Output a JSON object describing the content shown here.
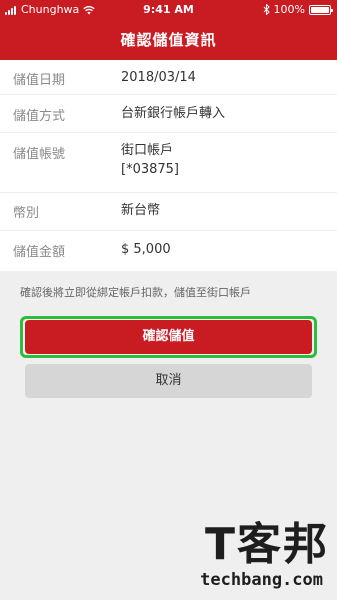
{
  "status_bar": {
    "carrier": "Chunghwa",
    "time": "9:41 AM",
    "battery": "100%"
  },
  "nav": {
    "title": "確認儲值資訊"
  },
  "info": {
    "rows": [
      {
        "label": "儲值日期",
        "value": "2018/03/14"
      },
      {
        "label": "儲值方式",
        "value": "台新銀行帳戶轉入"
      },
      {
        "label": "儲值帳號",
        "value": "街口帳戶",
        "value2": "[*03875]"
      },
      {
        "label": "幣別",
        "value": "新台幣"
      },
      {
        "label": "儲值金額",
        "value": "$ 5,000"
      }
    ]
  },
  "notice": "確認後將立即從綁定帳戶扣款，儲值至街口帳戶",
  "buttons": {
    "confirm": "確認儲值",
    "cancel": "取消"
  },
  "watermark": {
    "mark": "T客邦",
    "site": "techbang.com"
  },
  "colors": {
    "brand_red": "#c91b22",
    "highlight_green": "#2cbd3c",
    "cancel_gray": "#d6d6d6"
  }
}
